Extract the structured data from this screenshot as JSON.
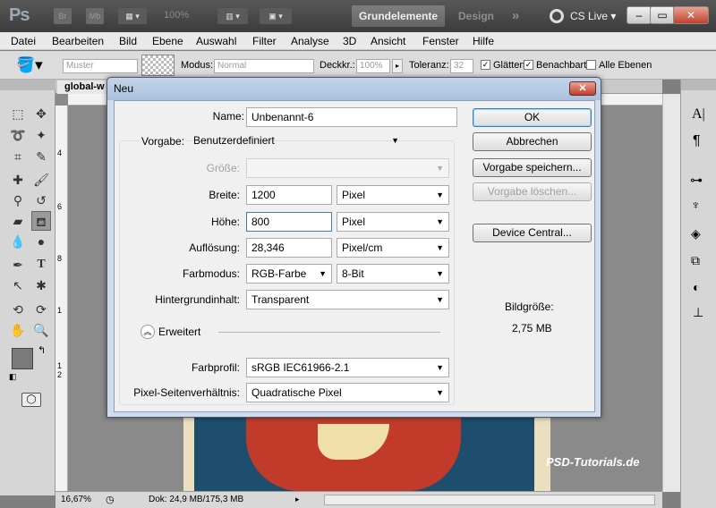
{
  "appbar": {
    "logo": "Ps",
    "icon_br": "Br",
    "icon_mb": "Mb",
    "zoom": "100%",
    "workspace_active": "Grundelemente",
    "workspace_other": "Design",
    "more": "»",
    "cslive": "CS Live",
    "win_min": "–",
    "win_restore": "▭",
    "win_close": "✕"
  },
  "menu": [
    "Datei",
    "Bearbeiten",
    "Bild",
    "Ebene",
    "Auswahl",
    "Filter",
    "Analyse",
    "3D",
    "Ansicht",
    "Fenster",
    "Hilfe"
  ],
  "options": {
    "muster": "Muster",
    "modus_label": "Modus:",
    "modus_value": "Normal",
    "deckkr_label": "Deckkr.:",
    "deckkr_value": "100%",
    "toleranz_label": "Toleranz:",
    "toleranz_value": "32",
    "glaetten": "Glätten",
    "benachbart": "Benachbart",
    "alle_ebenen": "Alle Ebenen"
  },
  "document": {
    "tab": "global-w",
    "zoom": "16,67%",
    "status": "Dok: 24,9 MB/175,3 MB",
    "watermark": "PSD-Tutorials.de",
    "ruler_marks": [
      "4",
      "6",
      "8",
      "1",
      "1",
      "2"
    ]
  },
  "dialog": {
    "title": "Neu",
    "name_label": "Name:",
    "name_value": "Unbenannt-6",
    "vorgabe_label": "Vorgabe:",
    "vorgabe_value": "Benutzerdefiniert",
    "groesse_label": "Größe:",
    "breite_label": "Breite:",
    "breite_value": "1200",
    "breite_unit": "Pixel",
    "hoehe_label": "Höhe:",
    "hoehe_value": "800",
    "hoehe_unit": "Pixel",
    "aufloesung_label": "Auflösung:",
    "aufloesung_value": "28,346",
    "aufloesung_unit": "Pixel/cm",
    "farbmodus_label": "Farbmodus:",
    "farbmodus_value": "RGB-Farbe",
    "farbtiefe_value": "8-Bit",
    "hintergrund_label": "Hintergrundinhalt:",
    "hintergrund_value": "Transparent",
    "erweitert": "Erweitert",
    "farbprofil_label": "Farbprofil:",
    "farbprofil_value": "sRGB IEC61966-2.1",
    "pixel_label": "Pixel-Seitenverhältnis:",
    "pixel_value": "Quadratische Pixel",
    "btn_ok": "OK",
    "btn_abbrechen": "Abbrechen",
    "btn_speichern": "Vorgabe speichern...",
    "btn_loeschen": "Vorgabe löschen...",
    "btn_device": "Device Central...",
    "bildgroesse_label": "Bildgröße:",
    "bildgroesse_value": "2,75 MB"
  },
  "colors": {
    "accent": "#3c7fb1",
    "appbar": "#474747"
  }
}
